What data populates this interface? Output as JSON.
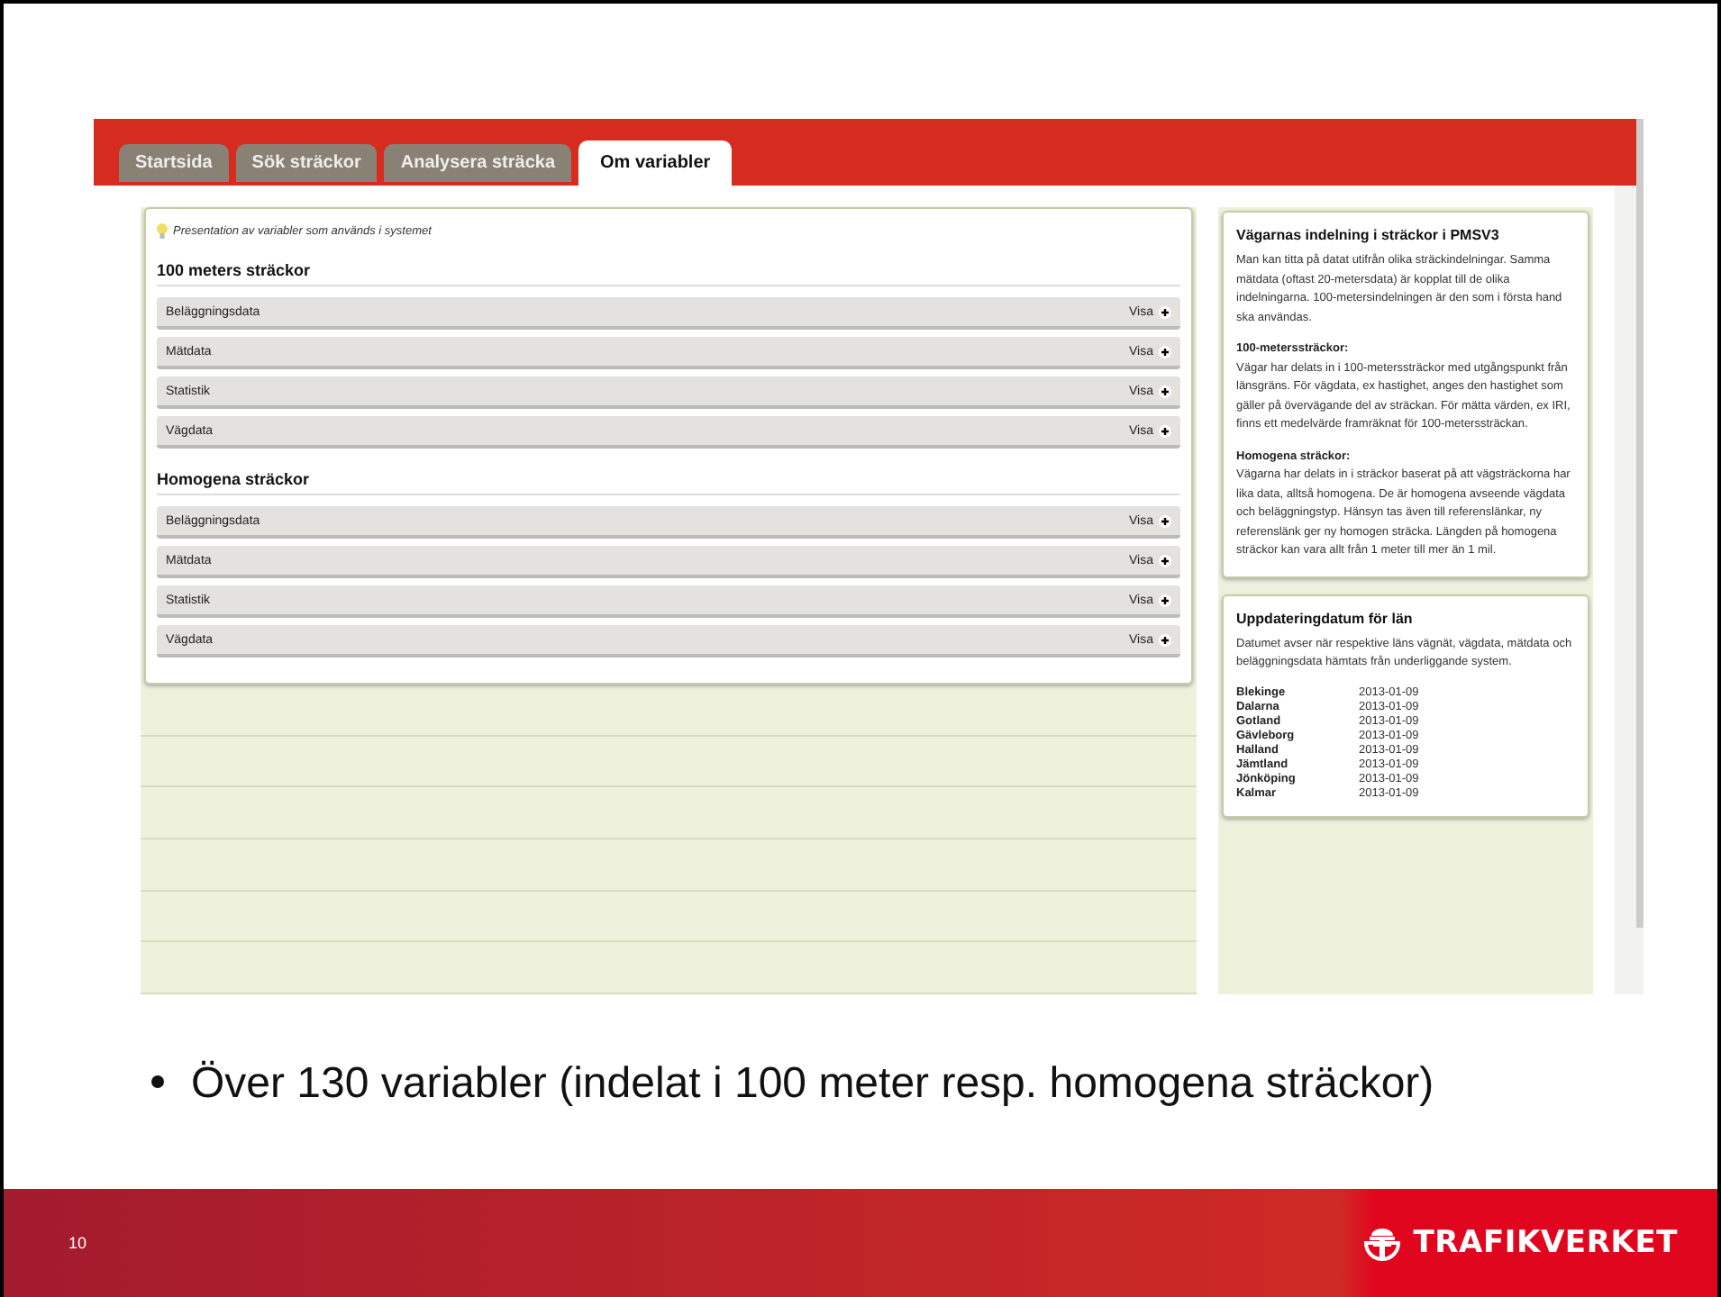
{
  "app": {
    "tabs": [
      {
        "label": "Startsida",
        "selected": false
      },
      {
        "label": "Sök sträckor",
        "selected": false
      },
      {
        "label": "Analysera sträcka",
        "selected": false
      },
      {
        "label": "Om variabler",
        "selected": true
      }
    ],
    "intro": "Presentation av variabler som används i systemet",
    "sections": [
      {
        "title": "100 meters sträckor",
        "rows": [
          {
            "label": "Beläggningsdata",
            "action": "Visa"
          },
          {
            "label": "Mätdata",
            "action": "Visa"
          },
          {
            "label": "Statistik",
            "action": "Visa"
          },
          {
            "label": "Vägdata",
            "action": "Visa"
          }
        ]
      },
      {
        "title": "Homogena sträckor",
        "rows": [
          {
            "label": "Beläggningsdata",
            "action": "Visa"
          },
          {
            "label": "Mätdata",
            "action": "Visa"
          },
          {
            "label": "Statistik",
            "action": "Visa"
          },
          {
            "label": "Vägdata",
            "action": "Visa"
          }
        ]
      }
    ],
    "info_panel": {
      "title": "Vägarnas indelning i sträckor i PMSV3",
      "intro": "Man kan titta på datat utifrån olika sträckindelningar. Samma mätdata (oftast 20-metersdata) är kopplat till de olika indelningarna. 100-metersindelningen är den som i första hand ska användas.",
      "paragraphs": [
        {
          "heading": "100-meterssträckor:",
          "text": "Vägar har delats in i 100-meterssträckor med utgångspunkt från länsgräns. För vägdata, ex hastighet, anges den hastighet som gäller på övervägande del av sträckan. För mätta värden, ex IRI, finns ett medelvärde framräknat för 100-meterssträckan."
        },
        {
          "heading": "Homogena sträckor:",
          "text": "Vägarna har delats in i sträckor baserat på att vägsträckorna har lika data, alltså homogena. De är homogena avseende vägdata och beläggningstyp. Hänsyn tas även till referenslänkar, ny referenslänk ger ny homogen sträcka. Längden på homogena sträckor kan vara allt från 1 meter till mer än 1 mil."
        }
      ]
    },
    "update_panel": {
      "title": "Uppdateringdatum för län",
      "intro": "Datumet avser när respektive läns vägnät, vägdata, mätdata och beläggningsdata hämtats från underliggande system.",
      "rows": [
        {
          "county": "Blekinge",
          "date": "2013-01-09"
        },
        {
          "county": "Dalarna",
          "date": "2013-01-09"
        },
        {
          "county": "Gotland",
          "date": "2013-01-09"
        },
        {
          "county": "Gävleborg",
          "date": "2013-01-09"
        },
        {
          "county": "Halland",
          "date": "2013-01-09"
        },
        {
          "county": "Jämtland",
          "date": "2013-01-09"
        },
        {
          "county": "Jönköping",
          "date": "2013-01-09"
        },
        {
          "county": "Kalmar",
          "date": "2013-01-09"
        }
      ]
    }
  },
  "bullets": [
    "Över 130 variabler (indelat i 100 meter resp. homogena sträckor)"
  ],
  "footer": {
    "page_number": "10",
    "logo_text": "TRAFIKVERKET"
  }
}
